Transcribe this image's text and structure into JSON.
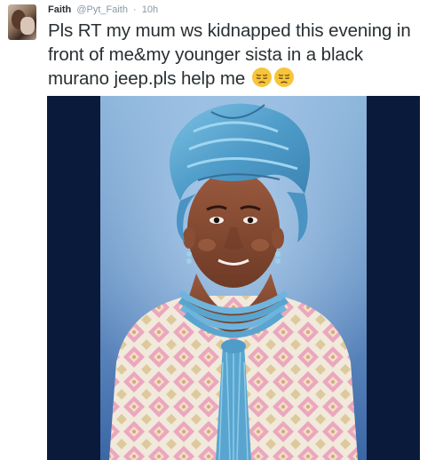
{
  "tweet": {
    "author_name": "Faith",
    "author_handle": "@Pyt_Faith",
    "separator": "·",
    "timestamp": "10h",
    "text": "Pls RT my mum ws kidnapped this evening in front of me&my younger sista in a black murano jeep.pls help me",
    "emojis": [
      "pensive-face-emoji",
      "pensive-face-emoji"
    ]
  },
  "colors": {
    "text": "#292f33",
    "muted": "#8899a6",
    "media_background": "#0a1a3a",
    "gele_blue": "#5aa5cf"
  }
}
